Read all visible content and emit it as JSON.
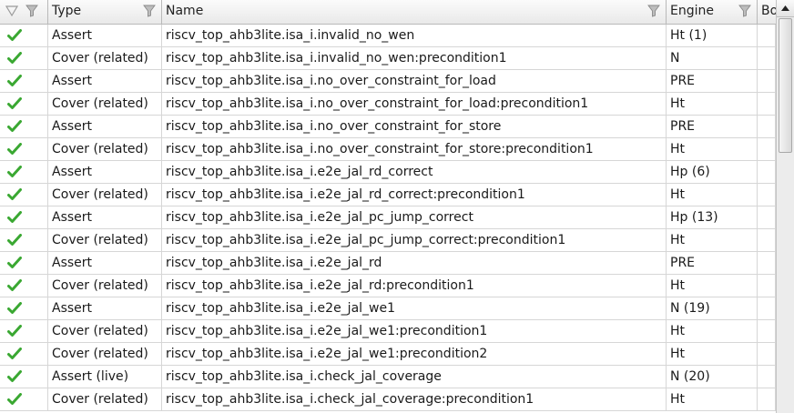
{
  "columns": {
    "status": "",
    "type": "Type",
    "name": "Name",
    "engine": "Engine",
    "bounded": "Bo"
  },
  "colors": {
    "check": "#3aa832",
    "grid": "#d6d6d6",
    "header_border": "#b9b9b9"
  },
  "icons": {
    "status": "check-icon",
    "filter": "filter-icon"
  },
  "rows": [
    {
      "type": "Assert",
      "name": "riscv_top_ahb3lite.isa_i.invalid_no_wen",
      "engine": "Ht (1)"
    },
    {
      "type": "Cover (related)",
      "name": "riscv_top_ahb3lite.isa_i.invalid_no_wen:precondition1",
      "engine": "N"
    },
    {
      "type": "Assert",
      "name": "riscv_top_ahb3lite.isa_i.no_over_constraint_for_load",
      "engine": "PRE"
    },
    {
      "type": "Cover (related)",
      "name": "riscv_top_ahb3lite.isa_i.no_over_constraint_for_load:precondition1",
      "engine": "Ht"
    },
    {
      "type": "Assert",
      "name": "riscv_top_ahb3lite.isa_i.no_over_constraint_for_store",
      "engine": "PRE"
    },
    {
      "type": "Cover (related)",
      "name": "riscv_top_ahb3lite.isa_i.no_over_constraint_for_store:precondition1",
      "engine": "Ht"
    },
    {
      "type": "Assert",
      "name": "riscv_top_ahb3lite.isa_i.e2e_jal_rd_correct",
      "engine": "Hp (6)"
    },
    {
      "type": "Cover (related)",
      "name": "riscv_top_ahb3lite.isa_i.e2e_jal_rd_correct:precondition1",
      "engine": "Ht"
    },
    {
      "type": "Assert",
      "name": "riscv_top_ahb3lite.isa_i.e2e_jal_pc_jump_correct",
      "engine": "Hp (13)"
    },
    {
      "type": "Cover (related)",
      "name": "riscv_top_ahb3lite.isa_i.e2e_jal_pc_jump_correct:precondition1",
      "engine": "Ht"
    },
    {
      "type": "Assert",
      "name": "riscv_top_ahb3lite.isa_i.e2e_jal_rd",
      "engine": "PRE"
    },
    {
      "type": "Cover (related)",
      "name": "riscv_top_ahb3lite.isa_i.e2e_jal_rd:precondition1",
      "engine": "Ht"
    },
    {
      "type": "Assert",
      "name": "riscv_top_ahb3lite.isa_i.e2e_jal_we1",
      "engine": "N (19)"
    },
    {
      "type": "Cover (related)",
      "name": "riscv_top_ahb3lite.isa_i.e2e_jal_we1:precondition1",
      "engine": "Ht"
    },
    {
      "type": "Cover (related)",
      "name": "riscv_top_ahb3lite.isa_i.e2e_jal_we1:precondition2",
      "engine": "Ht"
    },
    {
      "type": "Assert (live)",
      "name": "riscv_top_ahb3lite.isa_i.check_jal_coverage",
      "engine": "N (20)"
    },
    {
      "type": "Cover (related)",
      "name": "riscv_top_ahb3lite.isa_i.check_jal_coverage:precondition1",
      "engine": "Ht"
    }
  ]
}
